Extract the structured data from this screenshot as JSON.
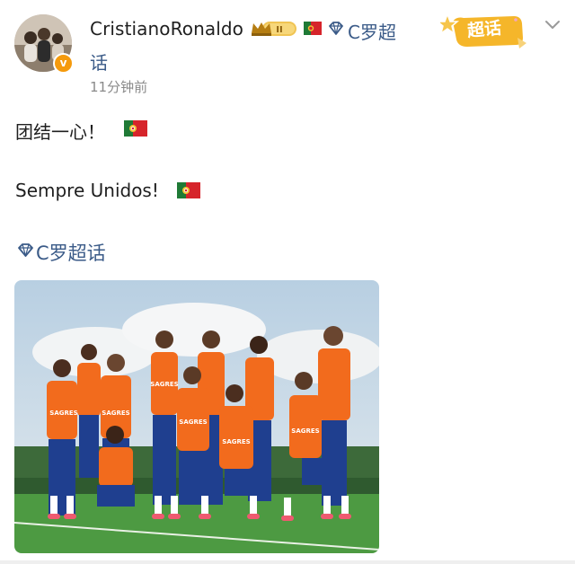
{
  "post": {
    "author": "CristianoRonaldo",
    "verified_mark": "v",
    "badges": {
      "crown_level": "II",
      "crown_icon": "crown-icon",
      "flag_icon": "portugal-flag-icon",
      "topic_icon": "diamond-icon"
    },
    "topic_inline": "C罗超",
    "topic_inline_wrap": "话",
    "timestamp": "11分钟前",
    "super_topic_label": "超话",
    "lines": [
      "团结一心！",
      "Sempre Unidos!"
    ],
    "topic_link": "C罗超话"
  },
  "photo": {
    "kit_text": "SAGRES",
    "colors": {
      "bib": "#f26b1d",
      "shirt": "#1f3f8f",
      "grass": "#3f8f3a",
      "sky": "#c9dbe9"
    }
  },
  "colors": {
    "link": "#3b5b88",
    "verified": "#f59a0c",
    "super_badge": "#f5b62a"
  }
}
